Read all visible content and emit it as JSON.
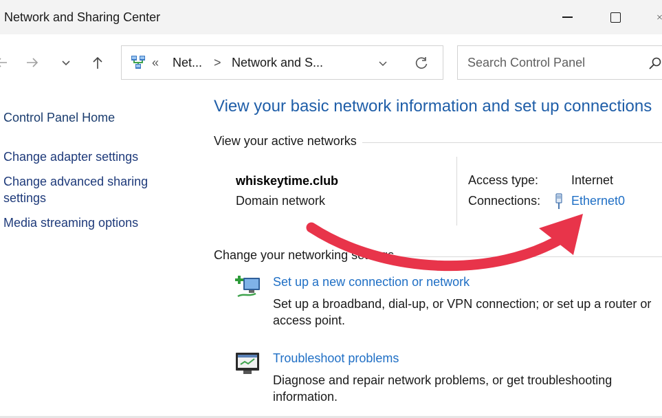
{
  "window": {
    "title": "Network and Sharing Center"
  },
  "nav": {
    "breadcrumb_prefix": "«",
    "breadcrumb_1": "Net...",
    "breadcrumb_sep": ">",
    "breadcrumb_2": "Network and S...",
    "search_placeholder": "Search Control Panel"
  },
  "sidebar": {
    "home": "Control Panel Home",
    "items": [
      {
        "label": "Change adapter settings"
      },
      {
        "label": "Change advanced sharing settings"
      },
      {
        "label": "Media streaming options"
      }
    ]
  },
  "main": {
    "heading": "View your basic network information and set up connections",
    "active_networks_label": "View your active networks",
    "network": {
      "name": "whiskeytime.club",
      "category": "Domain network",
      "access_type_label": "Access type:",
      "access_type_value": "Internet",
      "connections_label": "Connections:",
      "connection_link": "Ethernet0"
    },
    "change_settings_label": "Change your networking settings",
    "tasks": [
      {
        "title": "Set up a new connection or network",
        "description": "Set up a broadband, dial-up, or VPN connection; or set up a router or access point."
      },
      {
        "title": "Troubleshoot problems",
        "description": "Diagnose and repair network problems, or get troubleshooting information."
      }
    ]
  },
  "annotation": {
    "arrow_color": "#e8344a"
  },
  "icons": [
    "back-arrow-icon",
    "forward-arrow-icon",
    "recent-dropdown-icon",
    "up-arrow-icon",
    "network-location-icon",
    "address-chevron-icon",
    "refresh-icon",
    "search-icon",
    "minimize-icon",
    "maximize-icon",
    "close-icon",
    "ethernet-icon",
    "new-connection-icon",
    "troubleshoot-icon"
  ]
}
